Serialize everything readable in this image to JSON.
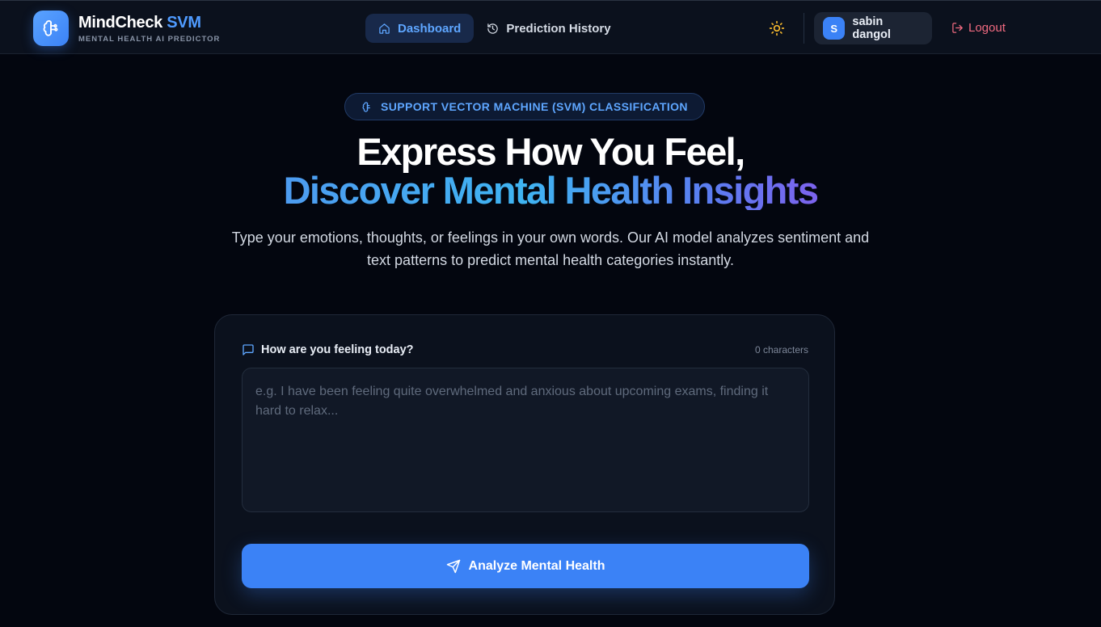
{
  "navbar": {
    "brand_name": "MindCheck",
    "brand_accent": "SVM",
    "brand_subtitle": "MENTAL HEALTH AI PREDICTOR",
    "links": [
      {
        "label": "Dashboard",
        "icon": "home-icon",
        "active": true
      },
      {
        "label": "Prediction History",
        "icon": "history-icon",
        "active": false
      }
    ],
    "theme_toggle_icon": "sun-icon",
    "user": {
      "initial": "S",
      "name": "sabin dangol"
    },
    "logout_label": "Logout"
  },
  "hero": {
    "badge": "SUPPORT VECTOR MACHINE (SVM) CLASSIFICATION",
    "title_line1": "Express How You Feel,",
    "title_line2": "Discover Mental Health Insights",
    "subtitle": "Type your emotions, thoughts, or feelings in your own words. Our AI model analyzes sentiment and text patterns to predict mental health categories instantly."
  },
  "form": {
    "label": "How are you feeling today?",
    "char_count": "0 characters",
    "value": "",
    "placeholder": "e.g. I have been feeling quite overwhelmed and anxious about upcoming exams, finding it hard to relax...",
    "submit_label": "Analyze Mental Health"
  },
  "colors": {
    "background": "#03060f",
    "navbar": "#0b111d",
    "accent": "#3b82f6",
    "accent_text": "#5ea6ff",
    "logout": "#f06a80",
    "sun": "#f5b82e"
  }
}
